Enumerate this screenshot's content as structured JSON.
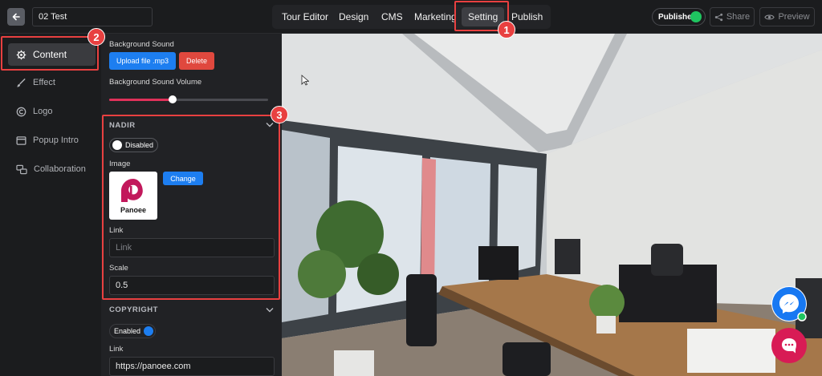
{
  "topbar": {
    "title_value": "02 Test",
    "nav": [
      "Tour Editor",
      "Design",
      "CMS",
      "Marketing",
      "Setting",
      "Publish"
    ],
    "active_nav": "Setting",
    "published_label": "Published",
    "share_label": "Share",
    "preview_label": "Preview"
  },
  "leftnav": {
    "items": [
      {
        "label": "Content",
        "icon": "gear-icon",
        "active": true
      },
      {
        "label": "Effect",
        "icon": "brush-icon",
        "active": false
      },
      {
        "label": "Logo",
        "icon": "copyright-icon",
        "active": false
      },
      {
        "label": "Popup Intro",
        "icon": "window-icon",
        "active": false
      },
      {
        "label": "Collaboration",
        "icon": "collaboration-icon",
        "active": false
      }
    ]
  },
  "panel": {
    "background_sound_label": "Background Sound",
    "upload_label": "Upload file .mp3",
    "delete_label": "Delete",
    "volume_label": "Background Sound Volume",
    "volume_value": 0.4,
    "nadir": {
      "heading": "NADIR",
      "toggle_label": "Disabled",
      "toggle_on": false,
      "image_label": "Image",
      "logo_text": "Panoee",
      "change_label": "Change",
      "link_label": "Link",
      "link_placeholder": "Link",
      "link_value": "",
      "scale_label": "Scale",
      "scale_value": "0.5"
    },
    "copyright": {
      "heading": "COPYRIGHT",
      "toggle_label": "Enabled",
      "toggle_on": true,
      "link_label": "Link",
      "link_value": "https://panoee.com"
    }
  },
  "callouts": [
    "1",
    "2",
    "3"
  ],
  "colors": {
    "accent_red": "#e84040",
    "blue": "#1d7ef0",
    "slider": "#e0315a",
    "published_green": "#1fc560",
    "messenger": "#1778f2",
    "chat": "#d81b55",
    "brand": "#c2185b"
  }
}
